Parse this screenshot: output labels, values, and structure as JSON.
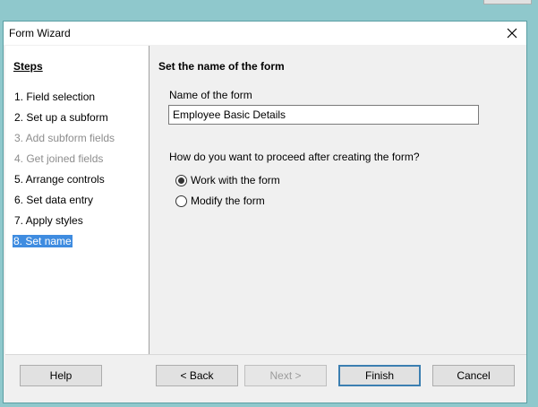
{
  "window": {
    "title": "Form Wizard"
  },
  "steps": {
    "heading": "Steps",
    "items": [
      {
        "label": "1. Field selection",
        "state": "enabled"
      },
      {
        "label": "2. Set up a subform",
        "state": "enabled"
      },
      {
        "label": "3. Add subform fields",
        "state": "disabled"
      },
      {
        "label": "4. Get joined fields",
        "state": "disabled"
      },
      {
        "label": "5. Arrange controls",
        "state": "enabled"
      },
      {
        "label": "6. Set data entry",
        "state": "enabled"
      },
      {
        "label": "7. Apply styles",
        "state": "enabled"
      },
      {
        "label": "8. Set name",
        "state": "active"
      }
    ]
  },
  "main": {
    "heading": "Set the name of the form",
    "name_label": "Name of the form",
    "name_value": "Employee Basic Details",
    "question": "How do you want to proceed after creating the form?",
    "options": [
      {
        "label": "Work with the form",
        "checked": true
      },
      {
        "label": "Modify the form",
        "checked": false
      }
    ]
  },
  "buttons": {
    "help": "Help",
    "back": "< Back",
    "next": "Next >",
    "finish": "Finish",
    "cancel": "Cancel"
  },
  "icons": {
    "close": "close-icon"
  },
  "colors": {
    "selection": "#3f8ce0",
    "desktop": "#8fc8cc"
  }
}
